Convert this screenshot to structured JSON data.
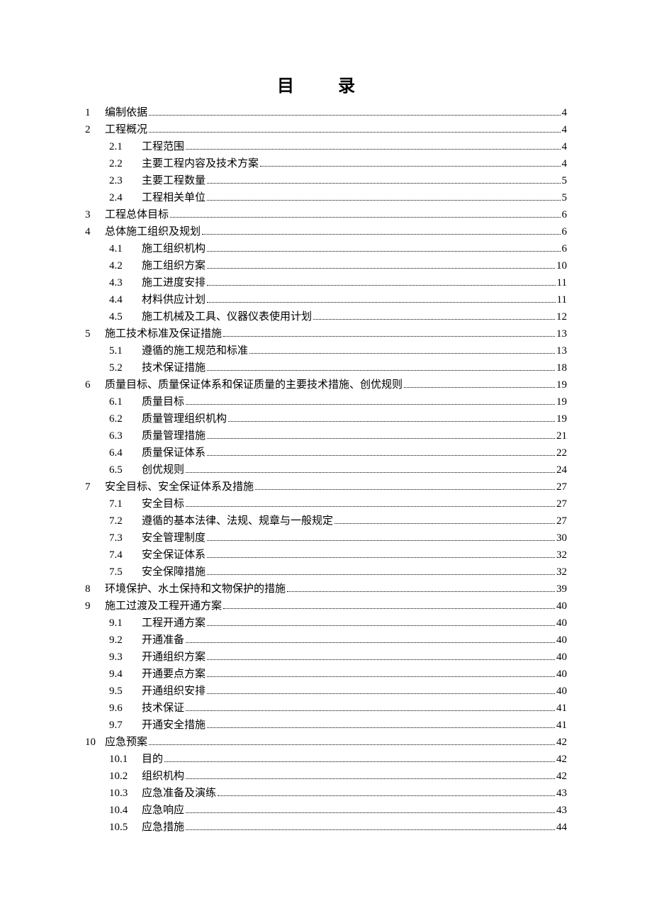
{
  "title": "目  录",
  "entries": [
    {
      "num": "1",
      "text": "编制依据",
      "page": "4",
      "level": 1
    },
    {
      "num": "2",
      "text": "工程概况",
      "page": "4",
      "level": 1
    },
    {
      "num": "2.1",
      "text": "工程范围",
      "page": "4",
      "level": 2
    },
    {
      "num": "2.2",
      "text": "主要工程内容及技术方案",
      "page": "4",
      "level": 2
    },
    {
      "num": "2.3",
      "text": "主要工程数量",
      "page": "5",
      "level": 2
    },
    {
      "num": "2.4",
      "text": "工程相关单位",
      "page": "5",
      "level": 2
    },
    {
      "num": "3",
      "text": "工程总体目标",
      "page": "6",
      "level": 1
    },
    {
      "num": "4",
      "text": "总体施工组织及规划",
      "page": "6",
      "level": 1
    },
    {
      "num": "4.1",
      "text": "施工组织机构",
      "page": "6",
      "level": 2
    },
    {
      "num": "4.2",
      "text": "施工组织方案",
      "page": "10",
      "level": 2
    },
    {
      "num": "4.3",
      "text": "施工进度安排",
      "page": "11",
      "level": 2
    },
    {
      "num": "4.4",
      "text": "材料供应计划",
      "page": "11",
      "level": 2
    },
    {
      "num": "4.5",
      "text": "施工机械及工具、仪器仪表使用计划",
      "page": "12",
      "level": 2
    },
    {
      "num": "5",
      "text": "施工技术标准及保证措施",
      "page": "13",
      "level": 1
    },
    {
      "num": "5.1",
      "text": "遵循的施工规范和标准",
      "page": "13",
      "level": 2
    },
    {
      "num": "5.2",
      "text": "技术保证措施",
      "page": "18",
      "level": 2
    },
    {
      "num": "6",
      "text": "质量目标、质量保证体系和保证质量的主要技术措施、创优规则",
      "page": "19",
      "level": 1
    },
    {
      "num": "6.1",
      "text": "质量目标",
      "page": "19",
      "level": 2
    },
    {
      "num": "6.2",
      "text": "质量管理组织机构",
      "page": "19",
      "level": 2
    },
    {
      "num": "6.3",
      "text": "质量管理措施",
      "page": "21",
      "level": 2
    },
    {
      "num": "6.4",
      "text": "质量保证体系",
      "page": "22",
      "level": 2
    },
    {
      "num": "6.5",
      "text": "创优规则",
      "page": "24",
      "level": 2
    },
    {
      "num": "7",
      "text": "安全目标、安全保证体系及措施",
      "page": "27",
      "level": 1
    },
    {
      "num": "7.1",
      "text": "安全目标",
      "page": "27",
      "level": 2
    },
    {
      "num": "7.2",
      "text": "遵循的基本法律、法规、规章与一般规定",
      "page": "27",
      "level": 2
    },
    {
      "num": "7.3",
      "text": "安全管理制度",
      "page": "30",
      "level": 2
    },
    {
      "num": "7.4",
      "text": "安全保证体系",
      "page": "32",
      "level": 2
    },
    {
      "num": "7.5",
      "text": "安全保障措施",
      "page": "32",
      "level": 2
    },
    {
      "num": "8",
      "text": "环境保护、水土保持和文物保护的措施",
      "page": "39",
      "level": 1
    },
    {
      "num": "9",
      "text": "施工过渡及工程开通方案",
      "page": "40",
      "level": 1
    },
    {
      "num": "9.1",
      "text": "工程开通方案",
      "page": "40",
      "level": 2
    },
    {
      "num": "9.2",
      "text": "开通准备",
      "page": "40",
      "level": 2
    },
    {
      "num": "9.3",
      "text": "开通组织方案",
      "page": "40",
      "level": 2
    },
    {
      "num": "9.4",
      "text": "开通要点方案",
      "page": "40",
      "level": 2
    },
    {
      "num": "9.5",
      "text": "开通组织安排",
      "page": "40",
      "level": 2
    },
    {
      "num": "9.6",
      "text": "技术保证",
      "page": "41",
      "level": 2
    },
    {
      "num": "9.7",
      "text": "开通安全措施",
      "page": "41",
      "level": 2
    },
    {
      "num": "10",
      "text": "应急预案",
      "page": "42",
      "level": 1
    },
    {
      "num": "10.1",
      "text": "目的",
      "page": "42",
      "level": 2
    },
    {
      "num": "10.2",
      "text": "组织机构",
      "page": "42",
      "level": 2
    },
    {
      "num": "10.3",
      "text": "应急准备及演练",
      "page": "43",
      "level": 2
    },
    {
      "num": "10.4",
      "text": "应急响应",
      "page": "43",
      "level": 2
    },
    {
      "num": "10.5",
      "text": "应急措施",
      "page": "44",
      "level": 2
    }
  ]
}
